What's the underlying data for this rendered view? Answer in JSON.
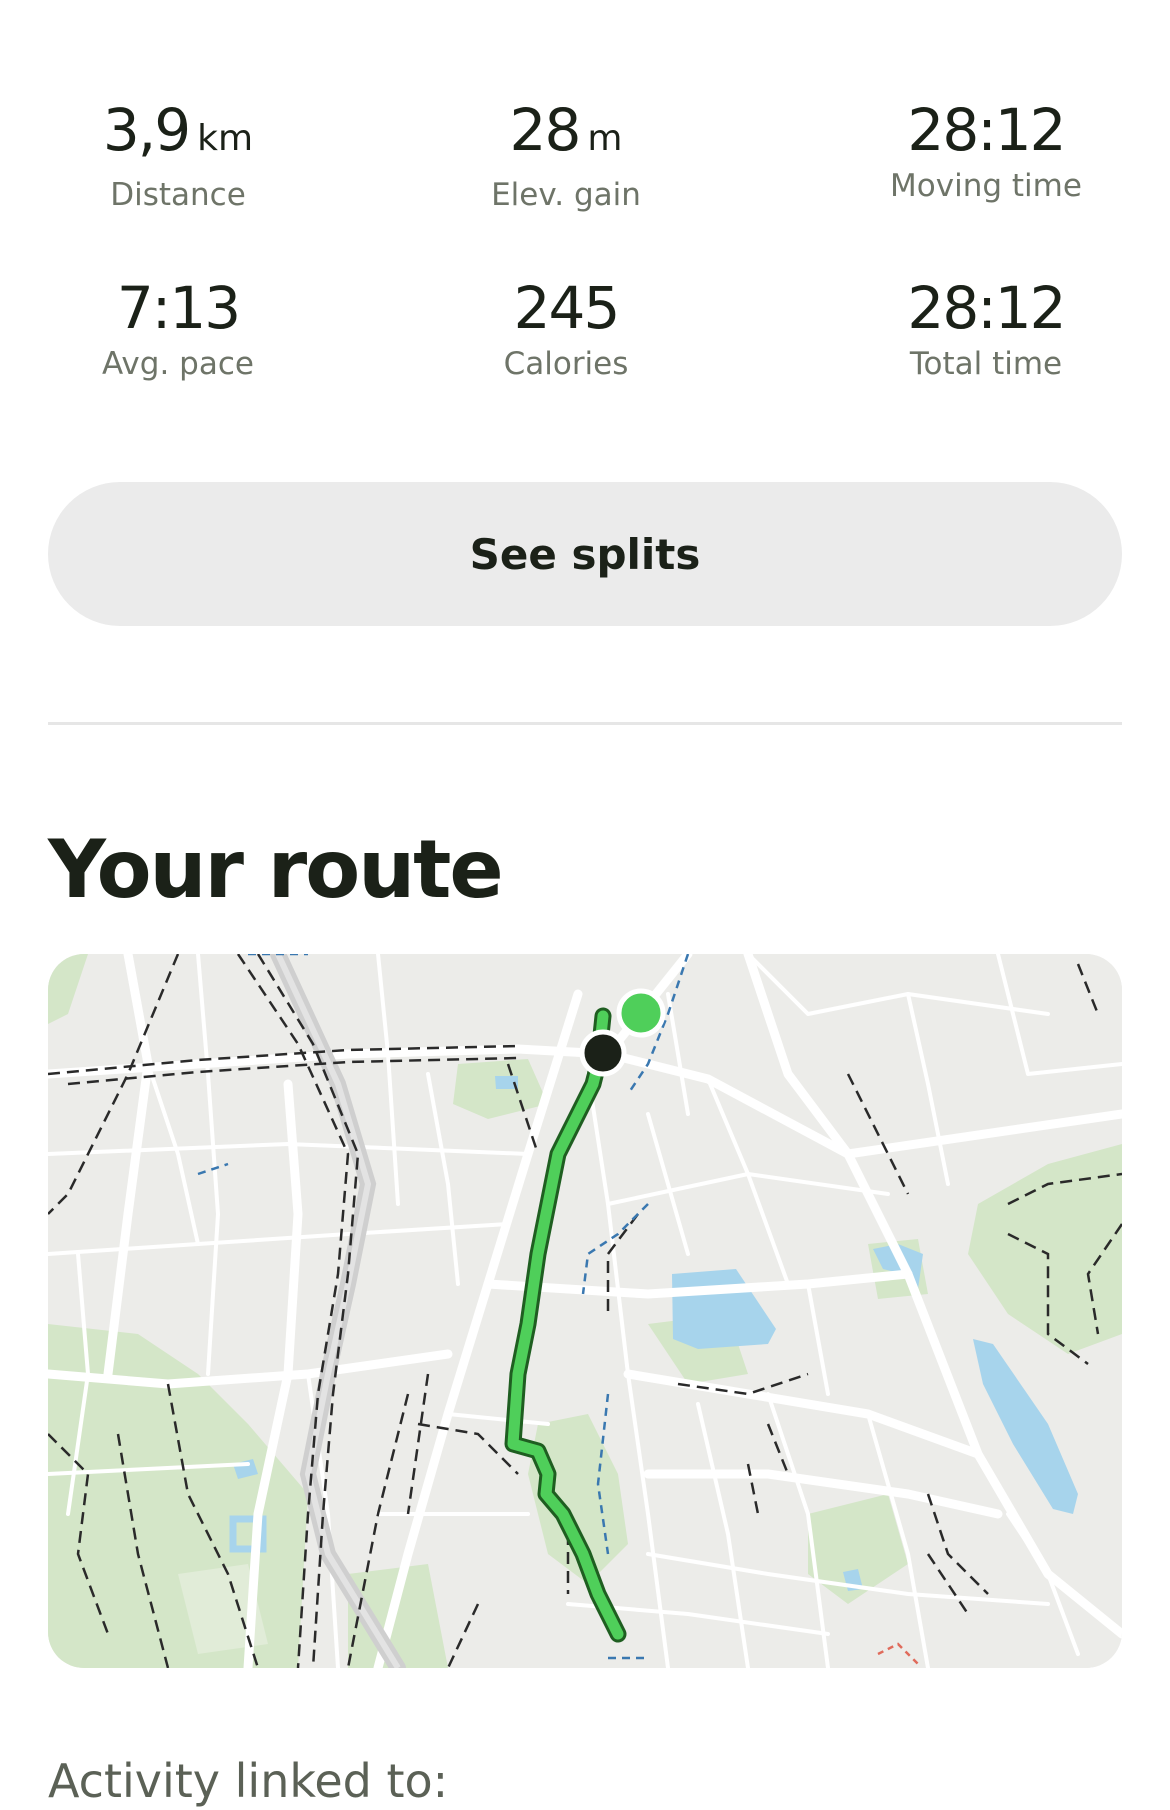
{
  "stats": [
    {
      "value": "3,9",
      "unit": "km",
      "label": "Distance"
    },
    {
      "value": "28",
      "unit": "m",
      "label": "Elev. gain"
    },
    {
      "value": "28:12",
      "unit": "",
      "label": "Moving time"
    },
    {
      "value": "7:13",
      "unit": "",
      "label": "Avg. pace"
    },
    {
      "value": "245",
      "unit": "",
      "label": "Calories"
    },
    {
      "value": "28:12",
      "unit": "",
      "label": "Total time"
    }
  ],
  "splits_button": {
    "label": "See splits"
  },
  "route": {
    "title": "Your route",
    "route_color": "#4fcf5a",
    "start_marker_color": "#4fcf5a",
    "end_marker_color": "#1b2118"
  },
  "linked": {
    "label": "Activity linked to:"
  },
  "colors": {
    "text": "#1b2118",
    "secondary_text": "#6e7468",
    "button_bg": "#ebebeb",
    "map_bg": "#ecece9",
    "park": "#d4e6c8",
    "water": "#a7d4ec"
  }
}
